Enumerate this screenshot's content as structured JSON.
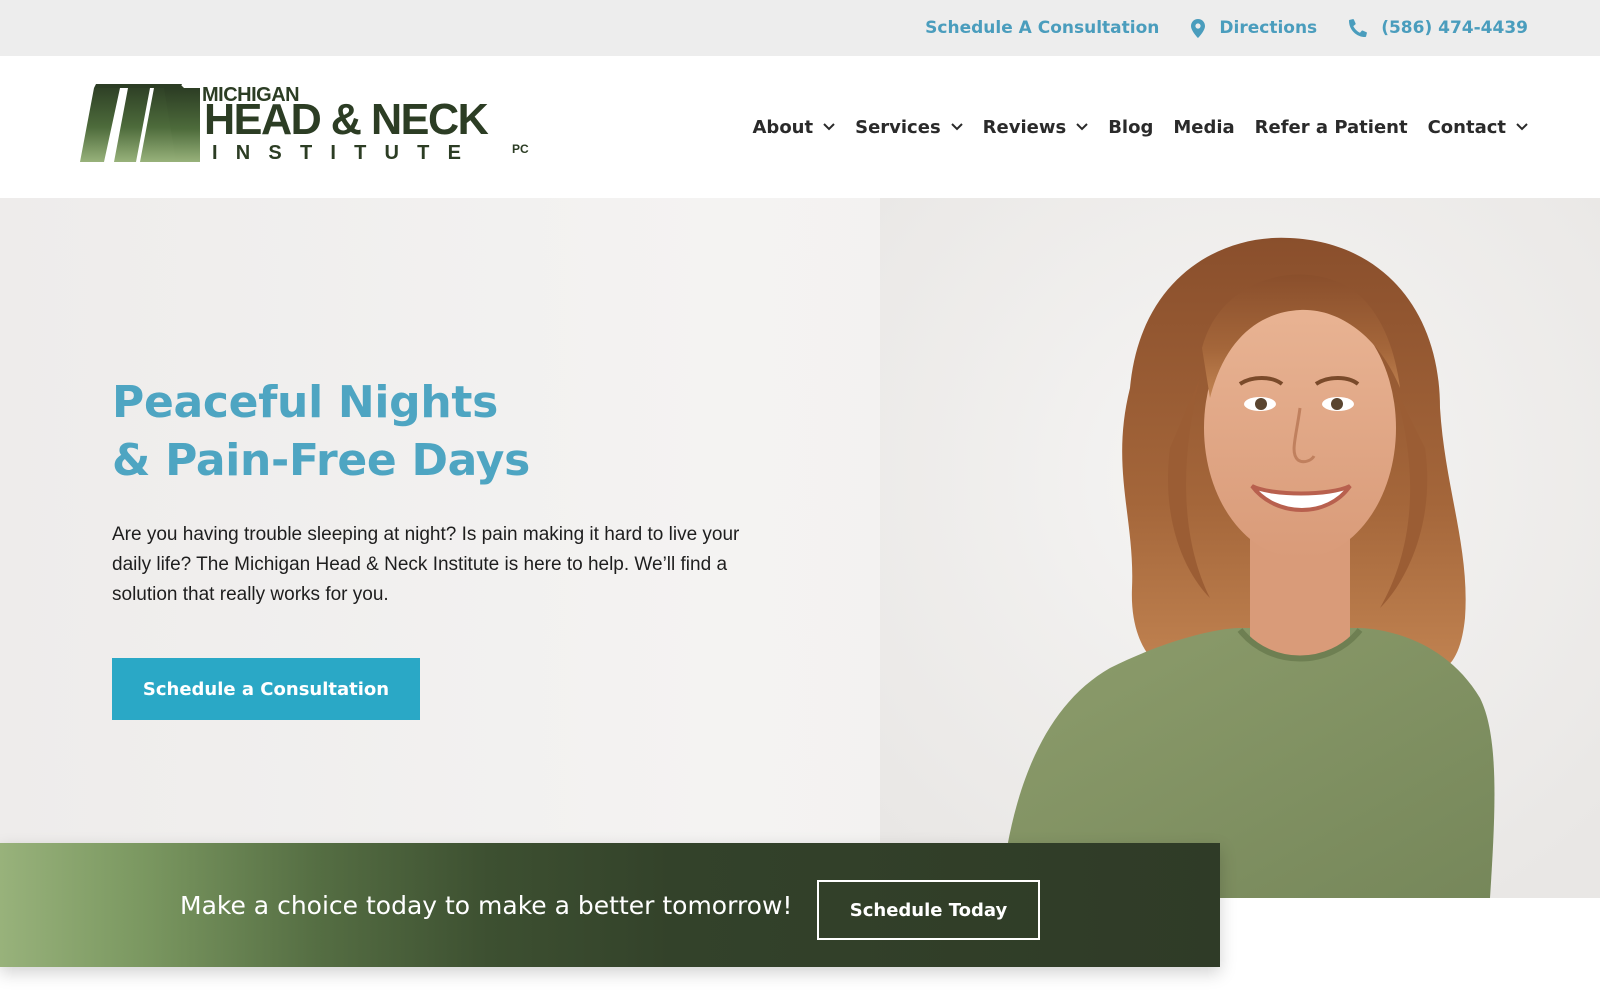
{
  "topbar": {
    "schedule_label": "Schedule A Consultation",
    "directions_label": "Directions",
    "phone_label": "(586) 474-4439",
    "directions_icon": "map-pin-icon",
    "phone_icon": "phone-icon"
  },
  "logo": {
    "top_text": "MICHIGAN",
    "main_text": "HEAD & NECK",
    "sub_text": "INSTITUTE",
    "suffix": "PC"
  },
  "nav": {
    "items": [
      {
        "label": "About",
        "has_dropdown": true
      },
      {
        "label": "Services",
        "has_dropdown": true
      },
      {
        "label": "Reviews",
        "has_dropdown": true
      },
      {
        "label": "Blog",
        "has_dropdown": false
      },
      {
        "label": "Media",
        "has_dropdown": false
      },
      {
        "label": "Refer a Patient",
        "has_dropdown": false
      },
      {
        "label": "Contact",
        "has_dropdown": true
      }
    ]
  },
  "hero": {
    "title_line1": "Peaceful Nights",
    "title_line2": "& Pain-Free Days",
    "body": "Are you having trouble sleeping at night? Is pain making it hard to live your daily life? The Michigan Head & Neck Institute is here to help. We’ll find a solution that really works for you.",
    "cta_label": "Schedule a Consultation"
  },
  "band": {
    "text": "Make a choice today to make a better tomorrow!",
    "button_label": "Schedule Today"
  },
  "colors": {
    "accent_blue": "#4ea5c2",
    "cta_blue": "#2aa8c6",
    "brand_green_dark": "#2c3d24",
    "band_green_light": "#98b27b",
    "band_green_dark": "#2f3b27"
  }
}
